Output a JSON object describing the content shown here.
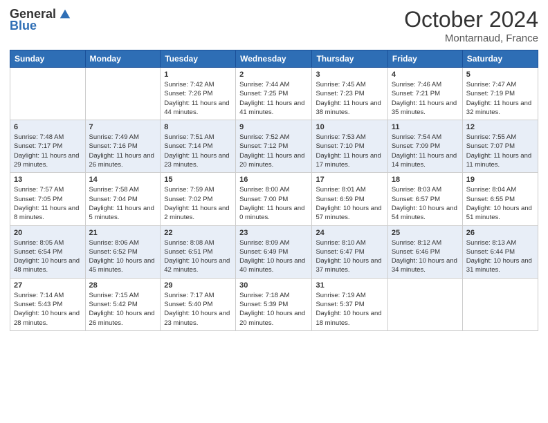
{
  "header": {
    "logo_general": "General",
    "logo_blue": "Blue",
    "month": "October 2024",
    "location": "Montarnaud, France"
  },
  "days_of_week": [
    "Sunday",
    "Monday",
    "Tuesday",
    "Wednesday",
    "Thursday",
    "Friday",
    "Saturday"
  ],
  "weeks": [
    [
      null,
      null,
      {
        "day": 1,
        "sunrise": "7:42 AM",
        "sunset": "7:26 PM",
        "daylight": "11 hours and 44 minutes."
      },
      {
        "day": 2,
        "sunrise": "7:44 AM",
        "sunset": "7:25 PM",
        "daylight": "11 hours and 41 minutes."
      },
      {
        "day": 3,
        "sunrise": "7:45 AM",
        "sunset": "7:23 PM",
        "daylight": "11 hours and 38 minutes."
      },
      {
        "day": 4,
        "sunrise": "7:46 AM",
        "sunset": "7:21 PM",
        "daylight": "11 hours and 35 minutes."
      },
      {
        "day": 5,
        "sunrise": "7:47 AM",
        "sunset": "7:19 PM",
        "daylight": "11 hours and 32 minutes."
      }
    ],
    [
      {
        "day": 6,
        "sunrise": "7:48 AM",
        "sunset": "7:17 PM",
        "daylight": "11 hours and 29 minutes."
      },
      {
        "day": 7,
        "sunrise": "7:49 AM",
        "sunset": "7:16 PM",
        "daylight": "11 hours and 26 minutes."
      },
      {
        "day": 8,
        "sunrise": "7:51 AM",
        "sunset": "7:14 PM",
        "daylight": "11 hours and 23 minutes."
      },
      {
        "day": 9,
        "sunrise": "7:52 AM",
        "sunset": "7:12 PM",
        "daylight": "11 hours and 20 minutes."
      },
      {
        "day": 10,
        "sunrise": "7:53 AM",
        "sunset": "7:10 PM",
        "daylight": "11 hours and 17 minutes."
      },
      {
        "day": 11,
        "sunrise": "7:54 AM",
        "sunset": "7:09 PM",
        "daylight": "11 hours and 14 minutes."
      },
      {
        "day": 12,
        "sunrise": "7:55 AM",
        "sunset": "7:07 PM",
        "daylight": "11 hours and 11 minutes."
      }
    ],
    [
      {
        "day": 13,
        "sunrise": "7:57 AM",
        "sunset": "7:05 PM",
        "daylight": "11 hours and 8 minutes."
      },
      {
        "day": 14,
        "sunrise": "7:58 AM",
        "sunset": "7:04 PM",
        "daylight": "11 hours and 5 minutes."
      },
      {
        "day": 15,
        "sunrise": "7:59 AM",
        "sunset": "7:02 PM",
        "daylight": "11 hours and 2 minutes."
      },
      {
        "day": 16,
        "sunrise": "8:00 AM",
        "sunset": "7:00 PM",
        "daylight": "11 hours and 0 minutes."
      },
      {
        "day": 17,
        "sunrise": "8:01 AM",
        "sunset": "6:59 PM",
        "daylight": "10 hours and 57 minutes."
      },
      {
        "day": 18,
        "sunrise": "8:03 AM",
        "sunset": "6:57 PM",
        "daylight": "10 hours and 54 minutes."
      },
      {
        "day": 19,
        "sunrise": "8:04 AM",
        "sunset": "6:55 PM",
        "daylight": "10 hours and 51 minutes."
      }
    ],
    [
      {
        "day": 20,
        "sunrise": "8:05 AM",
        "sunset": "6:54 PM",
        "daylight": "10 hours and 48 minutes."
      },
      {
        "day": 21,
        "sunrise": "8:06 AM",
        "sunset": "6:52 PM",
        "daylight": "10 hours and 45 minutes."
      },
      {
        "day": 22,
        "sunrise": "8:08 AM",
        "sunset": "6:51 PM",
        "daylight": "10 hours and 42 minutes."
      },
      {
        "day": 23,
        "sunrise": "8:09 AM",
        "sunset": "6:49 PM",
        "daylight": "10 hours and 40 minutes."
      },
      {
        "day": 24,
        "sunrise": "8:10 AM",
        "sunset": "6:47 PM",
        "daylight": "10 hours and 37 minutes."
      },
      {
        "day": 25,
        "sunrise": "8:12 AM",
        "sunset": "6:46 PM",
        "daylight": "10 hours and 34 minutes."
      },
      {
        "day": 26,
        "sunrise": "8:13 AM",
        "sunset": "6:44 PM",
        "daylight": "10 hours and 31 minutes."
      }
    ],
    [
      {
        "day": 27,
        "sunrise": "7:14 AM",
        "sunset": "5:43 PM",
        "daylight": "10 hours and 28 minutes."
      },
      {
        "day": 28,
        "sunrise": "7:15 AM",
        "sunset": "5:42 PM",
        "daylight": "10 hours and 26 minutes."
      },
      {
        "day": 29,
        "sunrise": "7:17 AM",
        "sunset": "5:40 PM",
        "daylight": "10 hours and 23 minutes."
      },
      {
        "day": 30,
        "sunrise": "7:18 AM",
        "sunset": "5:39 PM",
        "daylight": "10 hours and 20 minutes."
      },
      {
        "day": 31,
        "sunrise": "7:19 AM",
        "sunset": "5:37 PM",
        "daylight": "10 hours and 18 minutes."
      },
      null,
      null
    ]
  ]
}
